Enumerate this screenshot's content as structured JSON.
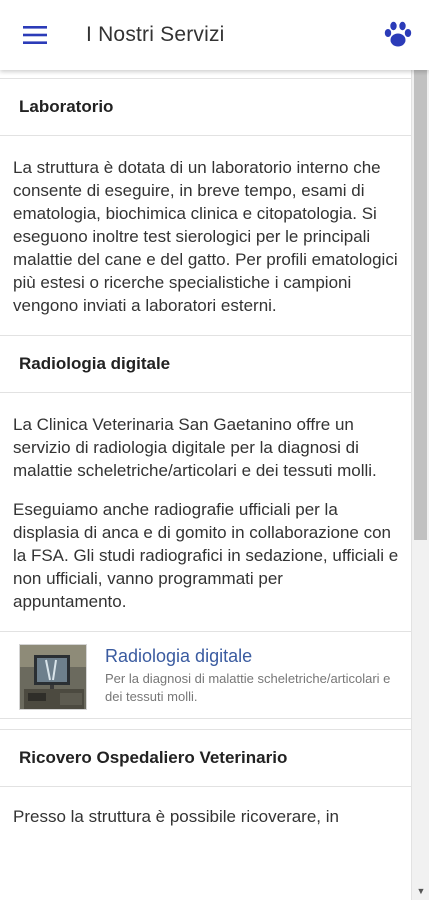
{
  "appbar": {
    "title": "I Nostri Servizi",
    "menu_icon": "hamburger-menu-icon",
    "brand_icon": "paw-icon",
    "accent": "#2b3bb8"
  },
  "sections": [
    {
      "title": "Laboratorio",
      "paragraphs": [
        "La struttura è dotata di un laboratorio interno che consente di eseguire, in breve tempo, esami di ematologia, biochimica clinica e citopatologia. Si eseguono inoltre test sierologici per le principali malattie del cane e del gatto. Per profili ematologici più estesi o ricerche specialistiche i campioni vengono inviati a laboratori esterni."
      ]
    },
    {
      "title": "Radiologia digitale",
      "paragraphs": [
        "La Clinica Veterinaria San Gaetanino offre un servizio di radiologia digitale per la diagnosi di malattie scheletriche/articolari e dei tessuti molli.",
        "Eseguiamo anche radiografie ufficiali per la displasia di anca e di gomito in collaborazione con la FSA. Gli studi radiografici in sedazione, ufficiali e non ufficiali, vanno programmati per appuntamento."
      ],
      "card": {
        "title": "Radiologia digitale",
        "subtitle": "Per la diagnosi di malattie scheletriche/articolari e dei tessuti molli."
      }
    },
    {
      "title": "Ricovero Ospedaliero Veterinario",
      "paragraphs": [
        "Presso la struttura è possibile ricoverare, in"
      ]
    }
  ]
}
